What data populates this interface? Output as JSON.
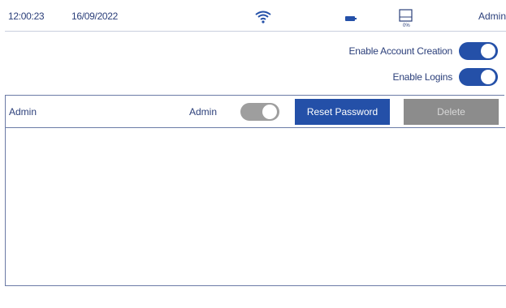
{
  "status_bar": {
    "time": "12:00:23",
    "date": "16/09/2022",
    "wifi_icon": "wifi-icon",
    "battery_icon": "battery-icon",
    "storage_icon": "storage-icon",
    "storage_percent": "0%",
    "user": "Admin"
  },
  "settings": {
    "account_creation": {
      "label": "Enable Account Creation",
      "enabled": true
    },
    "logins": {
      "label": "Enable Logins",
      "enabled": true
    }
  },
  "users": [
    {
      "name": "Admin",
      "role_label": "Admin",
      "admin_enabled": true,
      "reset_label": "Reset Password",
      "delete_label": "Delete"
    }
  ],
  "colors": {
    "accent": "#2450a8",
    "text": "#2b3f7a",
    "disabled": "#8c8c8c"
  }
}
